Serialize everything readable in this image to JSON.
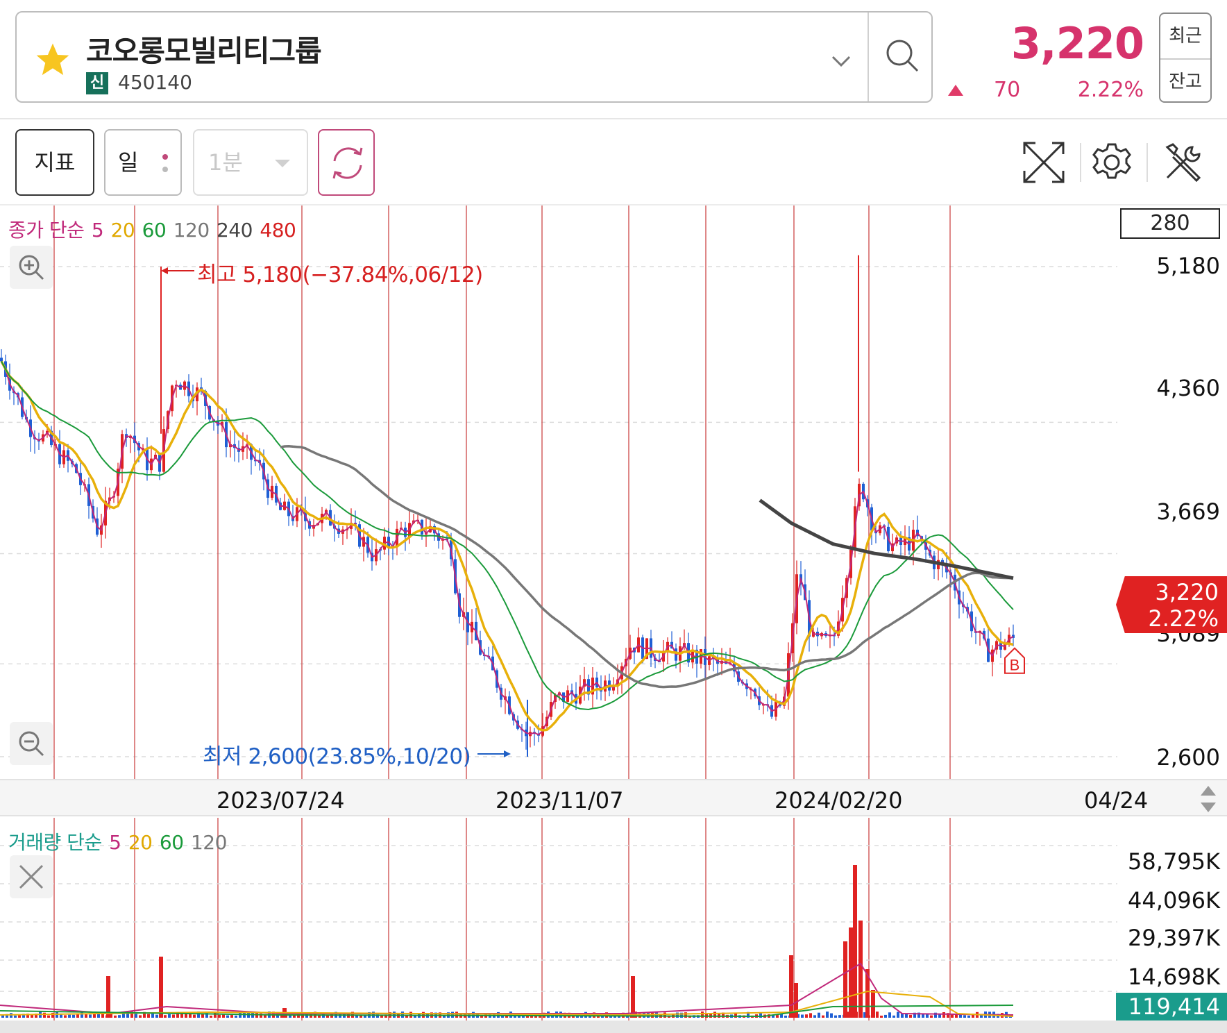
{
  "header": {
    "stock_name": "코오롱모빌리티그룹",
    "credit_badge": "신",
    "stock_code": "450140",
    "price": "3,220",
    "change": "70",
    "change_pct": "2.22%",
    "side_btn_recent": "최근",
    "side_btn_balance": "잔고",
    "colors": {
      "up": "#d6336c",
      "credit_badge": "#16705a"
    }
  },
  "toolbar": {
    "indicator_label": "지표",
    "period_label": "일",
    "minute_label": "1분",
    "icons": [
      "refresh-icon",
      "fullscreen-icon",
      "gear-icon",
      "tools-icon"
    ]
  },
  "price_chart": {
    "legend": {
      "prefix": "종가 단순",
      "ma": [
        "5",
        "20",
        "60",
        "120",
        "240",
        "480"
      ]
    },
    "scale": "280",
    "axis_labels": [
      "5,180",
      "4,360",
      "3,669",
      "3,089",
      "2,600"
    ],
    "current_tag": {
      "price": "3,220",
      "pct": "2.22%"
    },
    "high_annotation": "최고 5,180(−37.84%,06/12)",
    "low_annotation": "최저 2,600(23.85%,10/20)",
    "buy_marker": "B"
  },
  "x_axis": {
    "dates": [
      "2023/07/24",
      "2023/11/07",
      "2024/02/20",
      "04/24"
    ]
  },
  "volume_chart": {
    "legend": {
      "prefix": "거래량 단순",
      "ma": [
        "5",
        "20",
        "60",
        "120"
      ]
    },
    "axis_labels": [
      "58,795K",
      "44,096K",
      "29,397K",
      "14,698K"
    ],
    "current_volume": "119,414"
  },
  "chart_data": {
    "type": "candlestick",
    "y_axis_ticks": [
      5180,
      4360,
      3669,
      3089,
      2600
    ],
    "high": {
      "value": 5180,
      "date": "06/12"
    },
    "low": {
      "value": 2600,
      "date": "10/20"
    },
    "last": 3220,
    "moving_averages": [
      "5",
      "20",
      "60",
      "120",
      "240",
      "480"
    ],
    "volume_ticks": [
      "58,795K",
      "44,096K",
      "29,397K",
      "14,698K"
    ]
  }
}
